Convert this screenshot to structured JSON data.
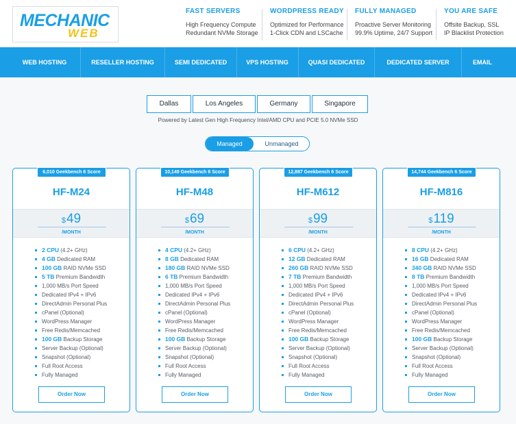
{
  "logo": {
    "word1": "MECHANIC",
    "word2": "WEB"
  },
  "features": [
    {
      "title": "FAST SERVERS",
      "line1": "High Frequency Compute",
      "line2": "Redundant NVMe Storage"
    },
    {
      "title": "WORDPRESS READY",
      "line1": "Optimized for Performance",
      "line2": "1-Click CDN and LSCache"
    },
    {
      "title": "FULLY MANAGED",
      "line1": "Proactive Server Monitoring",
      "line2": "99.9% Uptime, 24/7 Support"
    },
    {
      "title": "YOU ARE SAFE",
      "line1": "Offsite Backup, SSL",
      "line2": "IP Blacklist Protection"
    }
  ],
  "nav": [
    "WEB HOSTING",
    "RESELLER HOSTING",
    "SEMI DEDICATED",
    "VPS HOSTING",
    "QUASI DEDICATED",
    "DEDICATED SERVER",
    "EMAIL"
  ],
  "locations": [
    "Dallas",
    "Los Angeles",
    "Germany",
    "Singapore"
  ],
  "powered_by": "Powered by Latest Gen High Frequency Intel/AMD CPU and PCIE 5.0 NVMe SSD",
  "toggle": {
    "active": "Managed",
    "inactive": "Unmanaged"
  },
  "plans": [
    {
      "badge": "6,010 Geekbench 6 Score",
      "name": "HF-M24",
      "currency": "$",
      "price": "49",
      "period": "/MONTH",
      "features": [
        {
          "strong": "2 CPU",
          "text": " (4.2+ GHz)"
        },
        {
          "strong": "4 GB",
          "text": " Dedicated RAM"
        },
        {
          "strong": "100 GB",
          "text": " RAID NVMe SSD"
        },
        {
          "strong": "5 TB",
          "text": " Premium Bandwidth"
        },
        {
          "strong": "",
          "text": "1,000 MB/s Port Speed"
        },
        {
          "strong": "",
          "text": "Dedicated IPv4 + IPv6"
        },
        {
          "strong": "",
          "text": "DirectAdmin Personal Plus"
        },
        {
          "strong": "",
          "text": "cPanel (Optional)"
        },
        {
          "strong": "",
          "text": "WordPress Manager"
        },
        {
          "strong": "",
          "text": "Free Redis/Memcached"
        },
        {
          "strong": "100 GB",
          "text": " Backup Storage"
        },
        {
          "strong": "",
          "text": "Server Backup (Optional)"
        },
        {
          "strong": "",
          "text": "Snapshot (Optional)"
        },
        {
          "strong": "",
          "text": "Full Root Access"
        },
        {
          "strong": "",
          "text": "Fully Managed"
        }
      ],
      "order": "Order Now"
    },
    {
      "badge": "10,149 Geekbench 6 Score",
      "name": "HF-M48",
      "currency": "$",
      "price": "69",
      "period": "/MONTH",
      "features": [
        {
          "strong": "4 CPU",
          "text": " (4.2+ GHz)"
        },
        {
          "strong": "8 GB",
          "text": " Dedicated RAM"
        },
        {
          "strong": "180 GB",
          "text": " RAID NVMe SSD"
        },
        {
          "strong": "6 TB",
          "text": " Premium Bandwidth"
        },
        {
          "strong": "",
          "text": "1,000 MB/s Port Speed"
        },
        {
          "strong": "",
          "text": "Dedicated IPv4 + IPv6"
        },
        {
          "strong": "",
          "text": "DirectAdmin Personal Plus"
        },
        {
          "strong": "",
          "text": "cPanel (Optional)"
        },
        {
          "strong": "",
          "text": "WordPress Manager"
        },
        {
          "strong": "",
          "text": "Free Redis/Memcached"
        },
        {
          "strong": "100 GB",
          "text": " Backup Storage"
        },
        {
          "strong": "",
          "text": "Server Backup (Optional)"
        },
        {
          "strong": "",
          "text": "Snapshot (Optional)"
        },
        {
          "strong": "",
          "text": "Full Root Access"
        },
        {
          "strong": "",
          "text": "Fully Managed"
        }
      ],
      "order": "Order Now"
    },
    {
      "badge": "12,887 Geekbench 6 Score",
      "name": "HF-M612",
      "currency": "$",
      "price": "99",
      "period": "/MONTH",
      "features": [
        {
          "strong": "6 CPU",
          "text": " (4.2+ GHz)"
        },
        {
          "strong": "12 GB",
          "text": " Dedicated RAM"
        },
        {
          "strong": "260 GB",
          "text": " RAID NVMe SSD"
        },
        {
          "strong": "7 TB",
          "text": " Premium Bandwidth"
        },
        {
          "strong": "",
          "text": "1,000 MB/s Port Speed"
        },
        {
          "strong": "",
          "text": "Dedicated IPv4 + IPv6"
        },
        {
          "strong": "",
          "text": "DirectAdmin Personal Plus"
        },
        {
          "strong": "",
          "text": "cPanel (Optional)"
        },
        {
          "strong": "",
          "text": "WordPress Manager"
        },
        {
          "strong": "",
          "text": "Free Redis/Memcached"
        },
        {
          "strong": "100 GB",
          "text": " Backup Storage"
        },
        {
          "strong": "",
          "text": "Server Backup (Optional)"
        },
        {
          "strong": "",
          "text": "Snapshot (Optional)"
        },
        {
          "strong": "",
          "text": "Full Root Access"
        },
        {
          "strong": "",
          "text": "Fully Managed"
        }
      ],
      "order": "Order Now"
    },
    {
      "badge": "14,744 Geekbench 6 Score",
      "name": "HF-M816",
      "currency": "$",
      "price": "119",
      "period": "/MONTH",
      "features": [
        {
          "strong": "8 CPU",
          "text": " (4.2+ GHz)"
        },
        {
          "strong": "16 GB",
          "text": " Dedicated RAM"
        },
        {
          "strong": "340 GB",
          "text": " RAID NVMe SSD"
        },
        {
          "strong": "8 TB",
          "text": " Premium Bandwidth"
        },
        {
          "strong": "",
          "text": "1,000 MB/s Port Speed"
        },
        {
          "strong": "",
          "text": "Dedicated IPv4 + IPv6"
        },
        {
          "strong": "",
          "text": "DirectAdmin Personal Plus"
        },
        {
          "strong": "",
          "text": "cPanel (Optional)"
        },
        {
          "strong": "",
          "text": "WordPress Manager"
        },
        {
          "strong": "",
          "text": "Free Redis/Memcached"
        },
        {
          "strong": "100 GB",
          "text": " Backup Storage"
        },
        {
          "strong": "",
          "text": "Server Backup (Optional)"
        },
        {
          "strong": "",
          "text": "Snapshot (Optional)"
        },
        {
          "strong": "",
          "text": "Full Root Access"
        },
        {
          "strong": "",
          "text": "Fully Managed"
        }
      ],
      "order": "Order Now"
    }
  ],
  "colors": {
    "accent": "#1a9ee5",
    "logo_yellow": "#f4c21b",
    "price_bg": "#eef1f4"
  }
}
